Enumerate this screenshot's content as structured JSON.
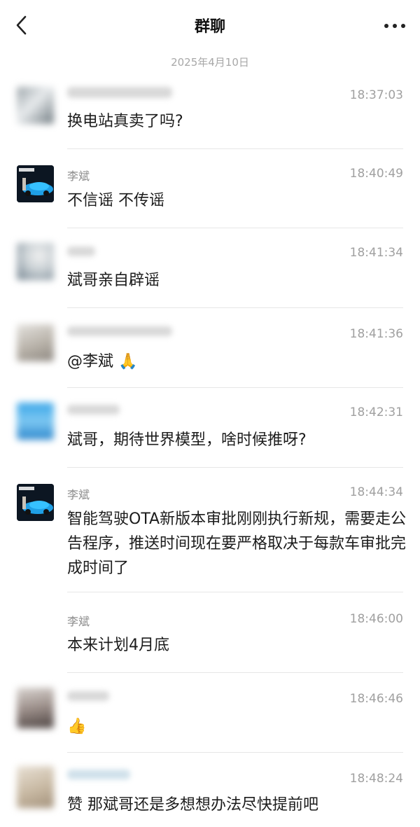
{
  "header": {
    "title": "群聊",
    "back_icon": "chevron-left-icon",
    "more_icon": "more-horizontal-icon"
  },
  "date_separator": "2025年4月10日",
  "messages": [
    {
      "sender": "",
      "time": "18:37:03",
      "text": "换电站真卖了吗?"
    },
    {
      "sender": "李斌",
      "time": "18:40:49",
      "text": "不信谣 不传谣"
    },
    {
      "sender": "",
      "time": "18:41:34",
      "text": "斌哥亲自辟谣"
    },
    {
      "sender": "",
      "time": "18:41:36",
      "text": "@李斌 🙏"
    },
    {
      "sender": "",
      "time": "18:42:31",
      "text": "斌哥，期待世界模型，啥时候推呀?"
    },
    {
      "sender": "李斌",
      "time": "18:44:34",
      "text": "智能驾驶OTA新版本审批刚刚执行新规，需要走公告程序，推送时间现在要严格取决于每款车审批完成时间了"
    },
    {
      "sender": "李斌",
      "time": "18:46:00",
      "text": "本来计划4月底"
    },
    {
      "sender": "",
      "time": "18:46:46",
      "text": "👍"
    },
    {
      "sender": "",
      "time": "18:48:24",
      "text": "赞 那斌哥还是多想想办法尽快提前吧"
    }
  ]
}
